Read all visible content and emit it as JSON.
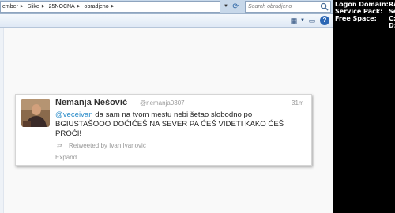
{
  "explorer": {
    "breadcrumb": [
      "ember",
      "Slike",
      "25NOCNA",
      "obradjeno"
    ],
    "search_placeholder": "Search obradjeno",
    "icons": {
      "refresh": "refresh-icon",
      "search": "search-icon",
      "views": "views-icon",
      "pane": "preview-pane-icon",
      "help": "help-icon"
    },
    "help_label": "?"
  },
  "tweet": {
    "name": "Nemanja Nešović",
    "handle": "@nemanja0307",
    "time": "31m",
    "mention": "@veceivan",
    "text": "da sam na tvom mestu nebi šetao slobodno po BGIUSTAŠOOO DOĆIĆEŠ NA SEVER PA ĆEŠ VIDETI KAKO ĆEŠ PROĆI!",
    "retweeted_by": "Retweeted by Ivan Ivanović",
    "expand": "Expand",
    "colors": {
      "link": "#2a8cc9",
      "muted": "#999999"
    }
  },
  "console": {
    "rows": [
      {
        "label": "Logon Domain:",
        "value": "RA"
      },
      {
        "label": "Service Pack:",
        "value": "Se"
      },
      {
        "label": "Free Space:",
        "value": "C:"
      },
      {
        "label": "",
        "value": "D:"
      }
    ]
  }
}
